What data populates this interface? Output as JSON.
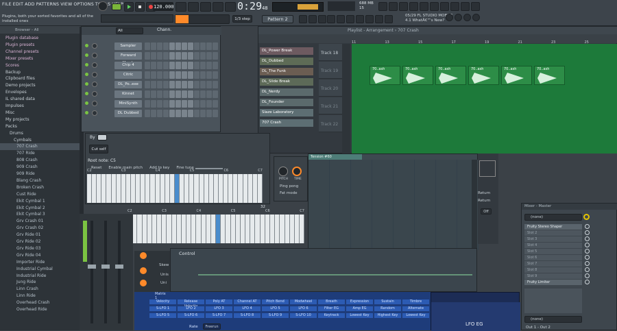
{
  "menu": [
    "FILE",
    "EDIT",
    "ADD",
    "PATTERNS",
    "VIEW",
    "OPTIONS",
    "TOOLS",
    "HELP"
  ],
  "hint": "Plugins, both your sorted favorites and all of the installed ones",
  "transport": {
    "tempo": "120.000",
    "time": "0:29",
    "time_frac": "48",
    "pattern": "Pattern 2",
    "step": "1/3 step",
    "memory": "688 MB",
    "cpu": "15"
  },
  "news": {
    "line1": "05/29  FL STUDIO MOBILE",
    "line2": "4.1 WhatÂ€™s New?"
  },
  "browser": {
    "header": "Browser - All",
    "items": [
      {
        "label": "Plugin database",
        "type": "folder"
      },
      {
        "label": "Plugin presets",
        "type": "folder"
      },
      {
        "label": "Channel presets",
        "type": "folder"
      },
      {
        "label": "Mixer presets",
        "type": "folder"
      },
      {
        "label": "Scores",
        "type": "folder"
      },
      {
        "label": "Backup",
        "type": "folder"
      },
      {
        "label": "Clipboard files",
        "type": "folder"
      },
      {
        "label": "Demo projects",
        "type": "folder"
      },
      {
        "label": "Envelopes",
        "type": "folder"
      },
      {
        "label": "IL shared data",
        "type": "folder"
      },
      {
        "label": "Impulses",
        "type": "folder"
      },
      {
        "label": "Misc",
        "type": "folder"
      },
      {
        "label": "My projects",
        "type": "folder"
      },
      {
        "label": "Packs",
        "type": "folder"
      },
      {
        "label": "Drums",
        "type": "folder"
      },
      {
        "label": "Cymbals",
        "type": "folder"
      },
      {
        "label": "707 Crash",
        "type": "file"
      },
      {
        "label": "707 Ride",
        "type": "file"
      },
      {
        "label": "808 Crash",
        "type": "file"
      },
      {
        "label": "909 Crash",
        "type": "file"
      },
      {
        "label": "909 Ride",
        "type": "file"
      },
      {
        "label": "Blang Crash",
        "type": "file"
      },
      {
        "label": "Broken Crash",
        "type": "file"
      },
      {
        "label": "Cust Ride",
        "type": "file"
      },
      {
        "label": "Ekit Cymbal 1",
        "type": "file"
      },
      {
        "label": "Ekit Cymbal 2",
        "type": "file"
      },
      {
        "label": "Ekit Cymbal 3",
        "type": "file"
      },
      {
        "label": "Grv Crash 01",
        "type": "file"
      },
      {
        "label": "Grv Crash 02",
        "type": "file"
      },
      {
        "label": "Grv Ride 01",
        "type": "file"
      },
      {
        "label": "Grv Ride 02",
        "type": "file"
      },
      {
        "label": "Grv Ride 03",
        "type": "file"
      },
      {
        "label": "Grv Ride 04",
        "type": "file"
      },
      {
        "label": "Importer Ride",
        "type": "file"
      },
      {
        "label": "Industrial Cymbal",
        "type": "file"
      },
      {
        "label": "Industrial Ride",
        "type": "file"
      },
      {
        "label": "Jung Ride",
        "type": "file"
      },
      {
        "label": "Linn Crash",
        "type": "file"
      },
      {
        "label": "Linn Ride",
        "type": "file"
      },
      {
        "label": "Overhead Crash",
        "type": "file"
      },
      {
        "label": "Overhead Ride",
        "type": "file"
      }
    ]
  },
  "channel_rack": {
    "filter": "All",
    "title": "Chann.",
    "channels": [
      "Sampler",
      "Forward March",
      "Chip 4",
      "Citric",
      "DL_Po..exe",
      "Kinnet",
      "MiniSynth",
      "DL Dubbed"
    ]
  },
  "playlist": {
    "title": "Playlist - Arrangement › 707 Crash",
    "patterns": [
      "DL_Power Break",
      "DL_Dubbed",
      "DL_The Funk",
      "DL_Slide Break",
      "DL_Nerdy",
      "DL_Founder",
      "Slaze Laboratory",
      "707 Crash"
    ],
    "tracks": [
      "Track 18",
      "Track 19",
      "Track 20",
      "Track 21",
      "Track 22"
    ],
    "bars": [
      "11",
      "13",
      "15",
      "17",
      "19",
      "21",
      "23",
      "25"
    ],
    "clip_label": "70..ash"
  },
  "sampler": {
    "root_note": "Root note: C5",
    "controls": [
      "Reset",
      "Enable main pitch",
      "Add to key",
      "Fine tune"
    ],
    "by": "By",
    "cut_self": "Cut self",
    "octaves": [
      "C2",
      "C3",
      "C4",
      "C5",
      "C6",
      "C7"
    ],
    "end_value": "32"
  },
  "knob_panel": {
    "pitch": "PITCH",
    "time": "TIME",
    "ping_pong": "Ping pong",
    "fat_mode": "Fat mode"
  },
  "piano_roll": {
    "label": "Tension #60"
  },
  "routing": {
    "return1": "Return",
    "return2": "Return",
    "off": "Off"
  },
  "mixer": {
    "title": "Mixer - Master",
    "none": "(none)",
    "slots": [
      "Fruity Stereo Shaper",
      "Slot 2",
      "Slot 3",
      "Slot 4",
      "Slot 5",
      "Slot 6",
      "Slot 7",
      "Slot 8",
      "Slot 9",
      "Fruity Limiter"
    ],
    "none2": "(none)",
    "out": "Out 1 - Out 2"
  },
  "control": {
    "label": "Control"
  },
  "mod_matrix": {
    "title": "Matrix 1",
    "sources": [
      "Velocity",
      "Release Velocity",
      "Poly AT",
      "Channel AT",
      "Pitch Bend",
      "Modwheel",
      "Breath",
      "Expression",
      "Sustain",
      "Timbre"
    ],
    "lfos_a": [
      "S-LFO 1",
      "LFO 2",
      "LFO 3",
      "LFO 4",
      "LFO 5",
      "LFO 6",
      "Filter EG",
      "Amp EG",
      "Random",
      "Alternate"
    ],
    "lfos_b": [
      "S-LFO 5",
      "S-LFO 6",
      "S-LFO 7",
      "S-LFO 8",
      "S-LFO 9",
      "S-LFO 10",
      "Keytrack",
      "Lowest Key",
      "Highest Key",
      "Lowest Key"
    ],
    "lfo_eg": "LFO EG",
    "rate": "Rate",
    "preset": "Freerun"
  },
  "left_knobs": [
    "Skew",
    "Unis",
    "Uni"
  ],
  "colors": {
    "accent": "#ff8a2a",
    "green": "#1d7a3a",
    "blue": "#1e3c7a",
    "highlight": "#4a8ccc"
  }
}
